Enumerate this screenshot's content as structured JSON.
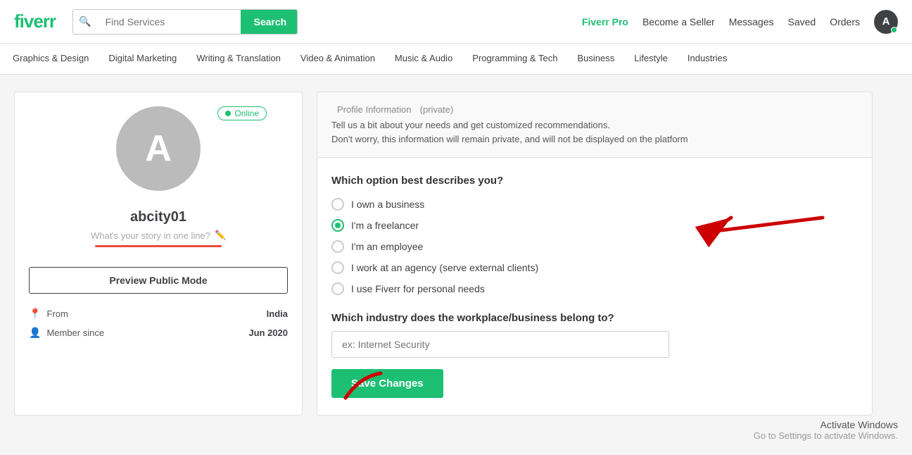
{
  "header": {
    "logo": "fiverr",
    "search_placeholder": "Find Services",
    "search_btn": "Search",
    "nav": {
      "pro": "Fiverr Pro",
      "become_seller": "Become a Seller",
      "messages": "Messages",
      "saved": "Saved",
      "orders": "Orders",
      "avatar_letter": "A"
    }
  },
  "categories": [
    "Graphics & Design",
    "Digital Marketing",
    "Writing & Translation",
    "Video & Animation",
    "Music & Audio",
    "Programming & Tech",
    "Business",
    "Lifestyle",
    "Industries"
  ],
  "profile_card": {
    "avatar_letter": "A",
    "online_label": "Online",
    "username": "abcity01",
    "tagline_placeholder": "What's your story in one line?",
    "preview_btn": "Preview Public Mode",
    "from_label": "From",
    "from_value": "India",
    "member_since_label": "Member since",
    "member_since_value": "Jun 2020"
  },
  "profile_info": {
    "title": "Profile Information",
    "private_label": "(private)",
    "desc_line1": "Tell us a bit about your needs and get customized recommendations.",
    "desc_line2": "Don't worry, this information will remain private, and will not be displayed on the platform"
  },
  "form": {
    "question1": "Which option best describes you?",
    "options": [
      {
        "id": "business",
        "label": "I own a business",
        "selected": false
      },
      {
        "id": "freelancer",
        "label": "I'm a freelancer",
        "selected": true
      },
      {
        "id": "employee",
        "label": "I'm an employee",
        "selected": false
      },
      {
        "id": "agency",
        "label": "I work at an agency (serve external clients)",
        "selected": false
      },
      {
        "id": "personal",
        "label": "I use Fiverr for personal needs",
        "selected": false
      }
    ],
    "question2": "Which industry does the workplace/business belong to?",
    "industry_placeholder": "ex: Internet Security",
    "save_btn": "Save Changes"
  },
  "watermark": {
    "title": "Activate Windows",
    "subtitle": "Go to Settings to activate Windows."
  }
}
